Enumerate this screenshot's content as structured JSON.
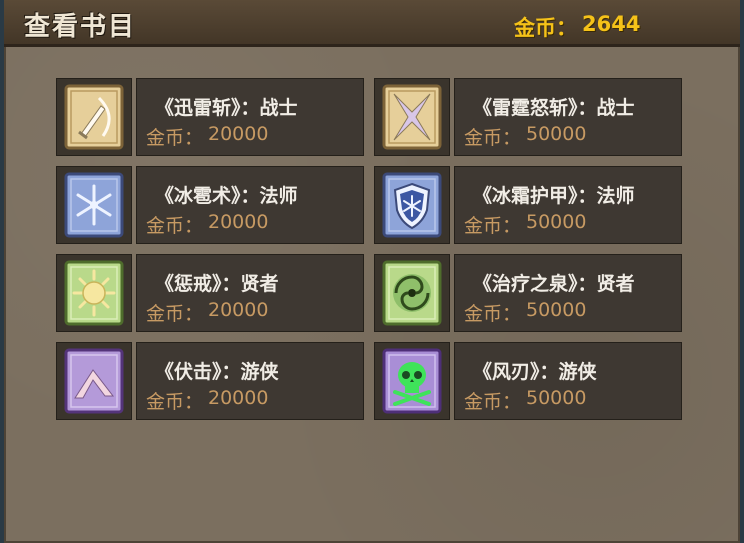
{
  "header": {
    "title": "查看书目",
    "gold_label": "金币：",
    "gold_value": "2644"
  },
  "cost_label": "金币：",
  "books": [
    {
      "name": "《迅雷斩》：战士",
      "cost": "20000",
      "icon": "sword-slash-icon",
      "color": "#e6cf9a"
    },
    {
      "name": "《雷霆怒斩》：战士",
      "cost": "50000",
      "icon": "cross-star-icon",
      "color": "#e6cf9a"
    },
    {
      "name": "《冰雹术》：法师",
      "cost": "20000",
      "icon": "snowflake-icon",
      "color": "#8ea4d9"
    },
    {
      "name": "《冰霜护甲》：法师",
      "cost": "50000",
      "icon": "frost-shield-icon",
      "color": "#8ea4d9"
    },
    {
      "name": "《惩戒》：贤者",
      "cost": "20000",
      "icon": "sun-icon",
      "color": "#b9d98a"
    },
    {
      "name": "《治疗之泉》：贤者",
      "cost": "50000",
      "icon": "swirl-icon",
      "color": "#b9d98a"
    },
    {
      "name": "《伏击》：游侠",
      "cost": "20000",
      "icon": "mountain-icon",
      "color": "#b49ad9"
    },
    {
      "name": "《风刃》：游侠",
      "cost": "50000",
      "icon": "skull-icon",
      "color": "#a98ed6"
    }
  ]
}
